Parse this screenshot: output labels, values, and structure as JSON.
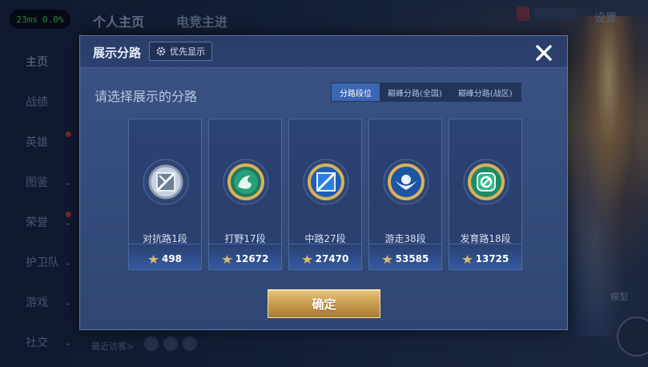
{
  "status": {
    "ping": "23ms",
    "loss": "0.0%"
  },
  "top_tabs": [
    {
      "label": "个人主页"
    },
    {
      "label": "电竞主进"
    }
  ],
  "settings_label": "设置",
  "side_nav": [
    {
      "label": "主页"
    },
    {
      "label": "战绩"
    },
    {
      "label": "英雄"
    },
    {
      "label": "图鉴"
    },
    {
      "label": "荣誉"
    },
    {
      "label": "护卫队"
    },
    {
      "label": "游戏"
    },
    {
      "label": "社交"
    }
  ],
  "recent_visitors": "最近访客>",
  "right_model_label": "模型",
  "dialog": {
    "title": "展示分路",
    "priority_label": "优先显示",
    "prompt": "请选择展示的分路",
    "tabs": [
      {
        "label": "分路段位",
        "active": true
      },
      {
        "label": "巅峰分路(全国)",
        "active": false
      },
      {
        "label": "巅峰分路(战区)",
        "active": false
      }
    ],
    "cards": [
      {
        "label": "对抗路1段",
        "score": "498",
        "icon": "clash-lane-icon",
        "accent": "#9aa6b8"
      },
      {
        "label": "打野17段",
        "score": "12672",
        "icon": "jungle-icon",
        "accent": "#2aa87a"
      },
      {
        "label": "中路27段",
        "score": "27470",
        "icon": "mid-lane-icon",
        "accent": "#3e8fe0"
      },
      {
        "label": "游走38段",
        "score": "53585",
        "icon": "roam-icon",
        "accent": "#3c7fd8"
      },
      {
        "label": "发育路18段",
        "score": "13725",
        "icon": "farm-lane-icon",
        "accent": "#2fb98c"
      }
    ],
    "confirm_label": "确定"
  }
}
